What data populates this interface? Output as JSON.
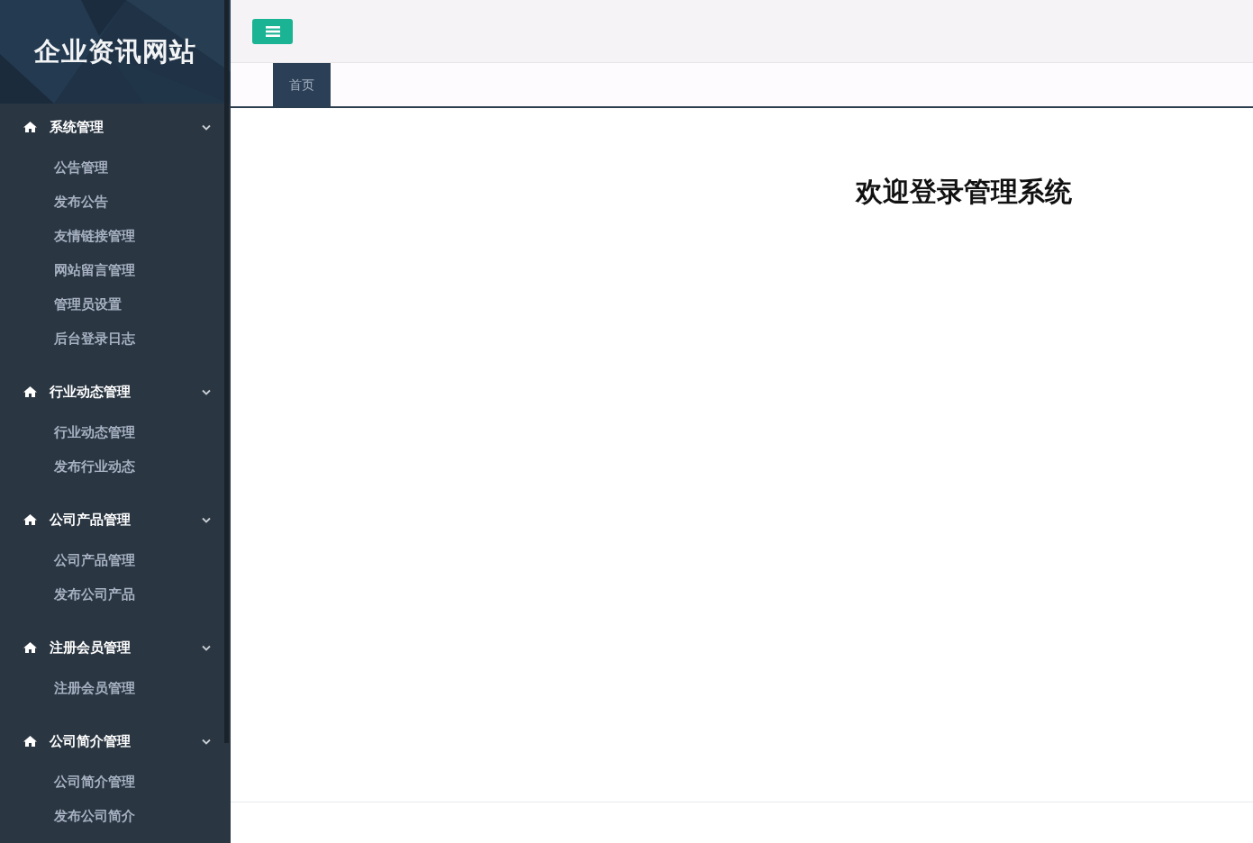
{
  "sidebar": {
    "site_title": "企业资讯网站",
    "sections": [
      {
        "label": "系统管理",
        "expanded": true,
        "items": [
          "公告管理",
          "发布公告",
          "友情链接管理",
          "网站留言管理",
          "管理员设置",
          "后台登录日志"
        ]
      },
      {
        "label": "行业动态管理",
        "expanded": true,
        "items": [
          "行业动态管理",
          "发布行业动态"
        ]
      },
      {
        "label": "公司产品管理",
        "expanded": true,
        "items": [
          "公司产品管理",
          "发布公司产品"
        ]
      },
      {
        "label": "注册会员管理",
        "expanded": true,
        "items": [
          "注册会员管理"
        ]
      },
      {
        "label": "公司简介管理",
        "expanded": true,
        "items": [
          "公司简介管理",
          "发布公司简介"
        ]
      }
    ]
  },
  "tabs": [
    {
      "label": "首页",
      "selected": true
    }
  ],
  "content": {
    "welcome_title": "欢迎登录管理系统"
  }
}
